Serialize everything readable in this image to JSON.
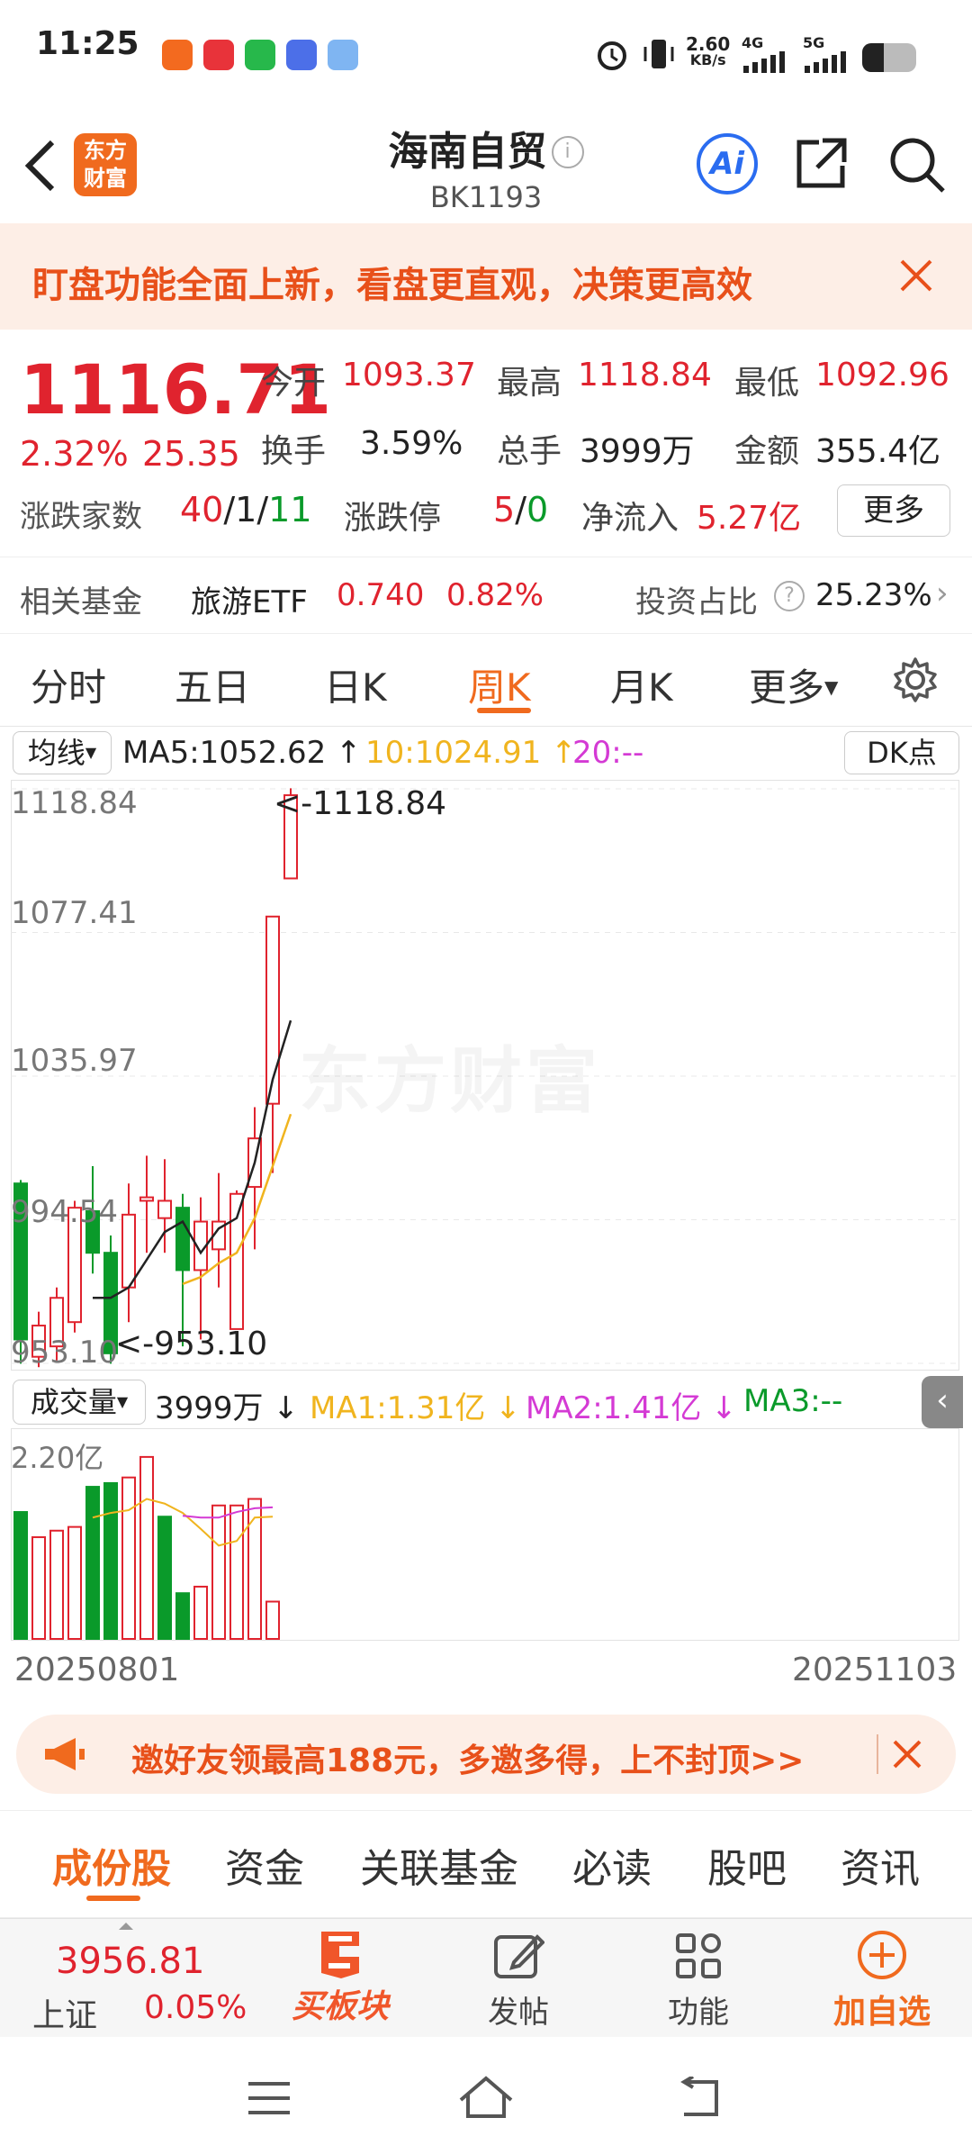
{
  "status_bar": {
    "time": "11:25",
    "net_speed": "2.60",
    "net_unit": "KB/s",
    "sig1": "4G",
    "sig2": "5G"
  },
  "header": {
    "logo_text": "东方财富",
    "title": "海南自贸",
    "code": "BK1193",
    "ai_label": "Ai"
  },
  "banner": {
    "text": "盯盘功能全面上新，看盘更直观，决策更高效"
  },
  "quote": {
    "price": "1116.71",
    "change_pct": "2.32%",
    "change_val": "25.35",
    "open_label": "今开",
    "open": "1093.37",
    "high_label": "最高",
    "high": "1118.84",
    "low_label": "最低",
    "low": "1092.96",
    "turnover_label": "换手",
    "turnover": "3.59%",
    "volume_label": "总手",
    "volume": "3999万",
    "amount_label": "金额",
    "amount": "355.4亿",
    "updown_label": "涨跌家数",
    "up": "40",
    "flat": "1",
    "down": "11",
    "sep": "/",
    "limit_label": "涨跌停",
    "limit_up": "5",
    "limit_down": "0",
    "netin_label": "净流入",
    "netin": "5.27亿",
    "more": "更多"
  },
  "fund": {
    "label": "相关基金",
    "name": "旅游ETF",
    "price": "0.740",
    "pct": "0.82%",
    "ratio_label": "投资占比",
    "ratio": "25.23%"
  },
  "tabs": [
    {
      "label": "分时"
    },
    {
      "label": "五日"
    },
    {
      "label": "日K"
    },
    {
      "label": "周K"
    },
    {
      "label": "月K"
    },
    {
      "label": "更多"
    }
  ],
  "ma_row": {
    "selector": "均线",
    "ma5": "MA5:1052.62",
    "ma10": "10:1024.91",
    "ma20": "20:--",
    "dk": "DK点"
  },
  "chart_y_labels": [
    "1118.84",
    "1077.41",
    "1035.97",
    "994.54",
    "953.10"
  ],
  "chart_annot": {
    "high": "<-1118.84",
    "low": "<-953.10"
  },
  "watermark": "东方财富",
  "vol_row": {
    "selector": "成交量",
    "vol": "3999万",
    "ma1": "MA1:1.31亿",
    "ma2": "MA2:1.41亿",
    "ma3": "MA3:--",
    "max_label": "2.20亿"
  },
  "dates": {
    "start": "20250801",
    "end": "20251103"
  },
  "promo": {
    "text": "邀好友领最高188元，多邀多得，上不封顶>>"
  },
  "subtabs": [
    {
      "label": "成份股"
    },
    {
      "label": "资金"
    },
    {
      "label": "关联基金"
    },
    {
      "label": "必读"
    },
    {
      "label": "股吧"
    },
    {
      "label": "资讯"
    }
  ],
  "bottom_bar": {
    "index_value": "3956.81",
    "index_name": "上证",
    "index_pct": "0.05%",
    "buy": "买板块",
    "post": "发帖",
    "func": "功能",
    "add": "加自选"
  },
  "colors": {
    "up": "#e0232e",
    "down": "#0a9a2a",
    "accent": "#f06a1e",
    "ma10": "#f0b41e",
    "ma2": "#d43ad4"
  },
  "chart_data": {
    "type": "candlestick",
    "y_range": [
      953.1,
      1118.84
    ],
    "candles": [
      {
        "o": 1005,
        "h": 1006,
        "l": 953,
        "c": 960,
        "up": false
      },
      {
        "o": 955,
        "h": 968,
        "l": 952,
        "c": 964,
        "up": true
      },
      {
        "o": 958,
        "h": 975,
        "l": 954,
        "c": 972,
        "up": true
      },
      {
        "o": 965,
        "h": 1000,
        "l": 962,
        "c": 998,
        "up": true
      },
      {
        "o": 997,
        "h": 1010,
        "l": 979,
        "c": 985,
        "up": false
      },
      {
        "o": 985,
        "h": 990,
        "l": 953,
        "c": 956,
        "up": false
      },
      {
        "o": 975,
        "h": 1005,
        "l": 965,
        "c": 996,
        "up": true
      },
      {
        "o": 1000,
        "h": 1013,
        "l": 985,
        "c": 1001,
        "up": true
      },
      {
        "o": 1000,
        "h": 1012,
        "l": 985,
        "c": 995,
        "up": true
      },
      {
        "o": 998,
        "h": 1002,
        "l": 958,
        "c": 980,
        "up": false
      },
      {
        "o": 980,
        "h": 1001,
        "l": 960,
        "c": 994,
        "up": true
      },
      {
        "o": 986,
        "h": 1008,
        "l": 975,
        "c": 994,
        "up": true
      },
      {
        "o": 963,
        "h": 1003,
        "l": 963,
        "c": 1002,
        "up": true
      },
      {
        "o": 1004,
        "h": 1027,
        "l": 986,
        "c": 1018,
        "up": true
      },
      {
        "o": 1028,
        "h": 1078,
        "l": 1008,
        "c": 1082,
        "up": true
      },
      {
        "o": 1093,
        "h": 1119,
        "l": 1093,
        "c": 1117,
        "up": true
      }
    ],
    "ma5": [
      null,
      null,
      null,
      null,
      972,
      972,
      975,
      983,
      991,
      994,
      985,
      992,
      995,
      1011,
      1035,
      1052
    ],
    "ma10": [
      null,
      null,
      null,
      null,
      null,
      null,
      null,
      null,
      null,
      976,
      978,
      982,
      985,
      995,
      1010,
      1025
    ],
    "volume_max": 2.2,
    "volume": [
      {
        "v": 1.36,
        "up": false
      },
      {
        "v": 1.09,
        "up": true
      },
      {
        "v": 1.16,
        "up": true
      },
      {
        "v": 1.2,
        "up": true
      },
      {
        "v": 1.63,
        "up": false
      },
      {
        "v": 1.67,
        "up": false
      },
      {
        "v": 1.73,
        "up": true
      },
      {
        "v": 1.95,
        "up": true
      },
      {
        "v": 1.31,
        "up": false
      },
      {
        "v": 0.49,
        "up": false
      },
      {
        "v": 0.56,
        "up": true
      },
      {
        "v": 1.43,
        "up": true
      },
      {
        "v": 1.43,
        "up": true
      },
      {
        "v": 1.5,
        "up": true
      },
      {
        "v": 0.4,
        "up": true
      }
    ],
    "vol_ma1": [
      null,
      null,
      null,
      null,
      1.3,
      1.35,
      1.38,
      1.5,
      1.45,
      1.35,
      1.18,
      1.0,
      1.05,
      1.3,
      1.31
    ],
    "vol_ma2": [
      null,
      null,
      null,
      null,
      null,
      null,
      null,
      null,
      null,
      1.32,
      1.3,
      1.3,
      1.36,
      1.4,
      1.41
    ]
  }
}
